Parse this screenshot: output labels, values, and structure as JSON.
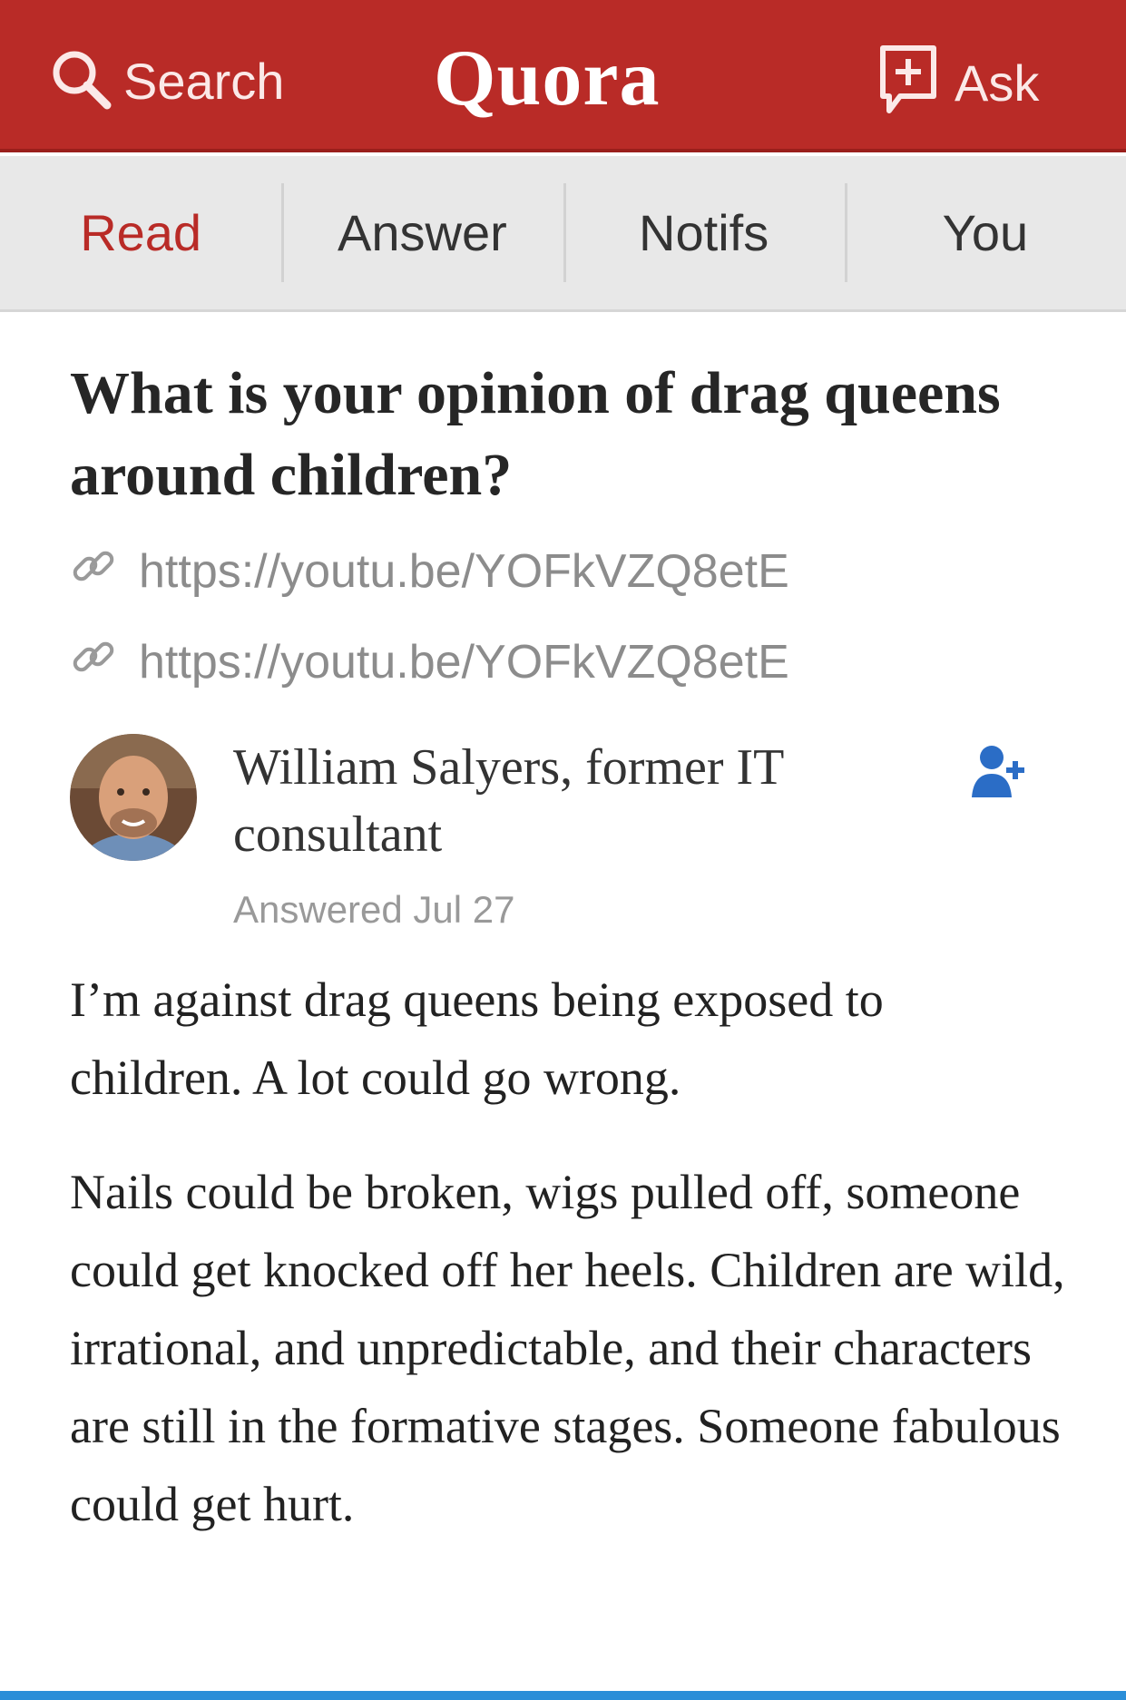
{
  "header": {
    "search_label": "Search",
    "brand": "Quora",
    "ask_label": "Ask",
    "bg_color": "#b92b27"
  },
  "tabs": [
    {
      "label": "Read",
      "active": true
    },
    {
      "label": "Answer",
      "active": false
    },
    {
      "label": "Notifs",
      "active": false
    },
    {
      "label": "You",
      "active": false
    }
  ],
  "question": {
    "title": "What is your opinion of drag queens around children?",
    "links": [
      "https://youtu.be/YOFkVZQ8etE",
      "https://youtu.be/YOFkVZQ8etE"
    ]
  },
  "answer": {
    "author": "William Salyers, former IT consultant",
    "answered": "Answered Jul 27",
    "paragraphs": [
      "I’m against drag queens being exposed to children. A lot could go wrong.",
      "Nails could be broken, wigs pulled off, someone could get knocked off her heels. Children are wild, irrational, and unpredictable, and their characters are still in the formative stages. Someone fabulous could get hurt."
    ]
  },
  "icons": {
    "search": "search-icon",
    "ask": "ask-plus-icon",
    "link": "link-icon",
    "follow": "follow-user-icon"
  },
  "colors": {
    "brand_red": "#b92b27",
    "follow_blue": "#2b6dc6",
    "muted_text": "#8c8c8c"
  }
}
